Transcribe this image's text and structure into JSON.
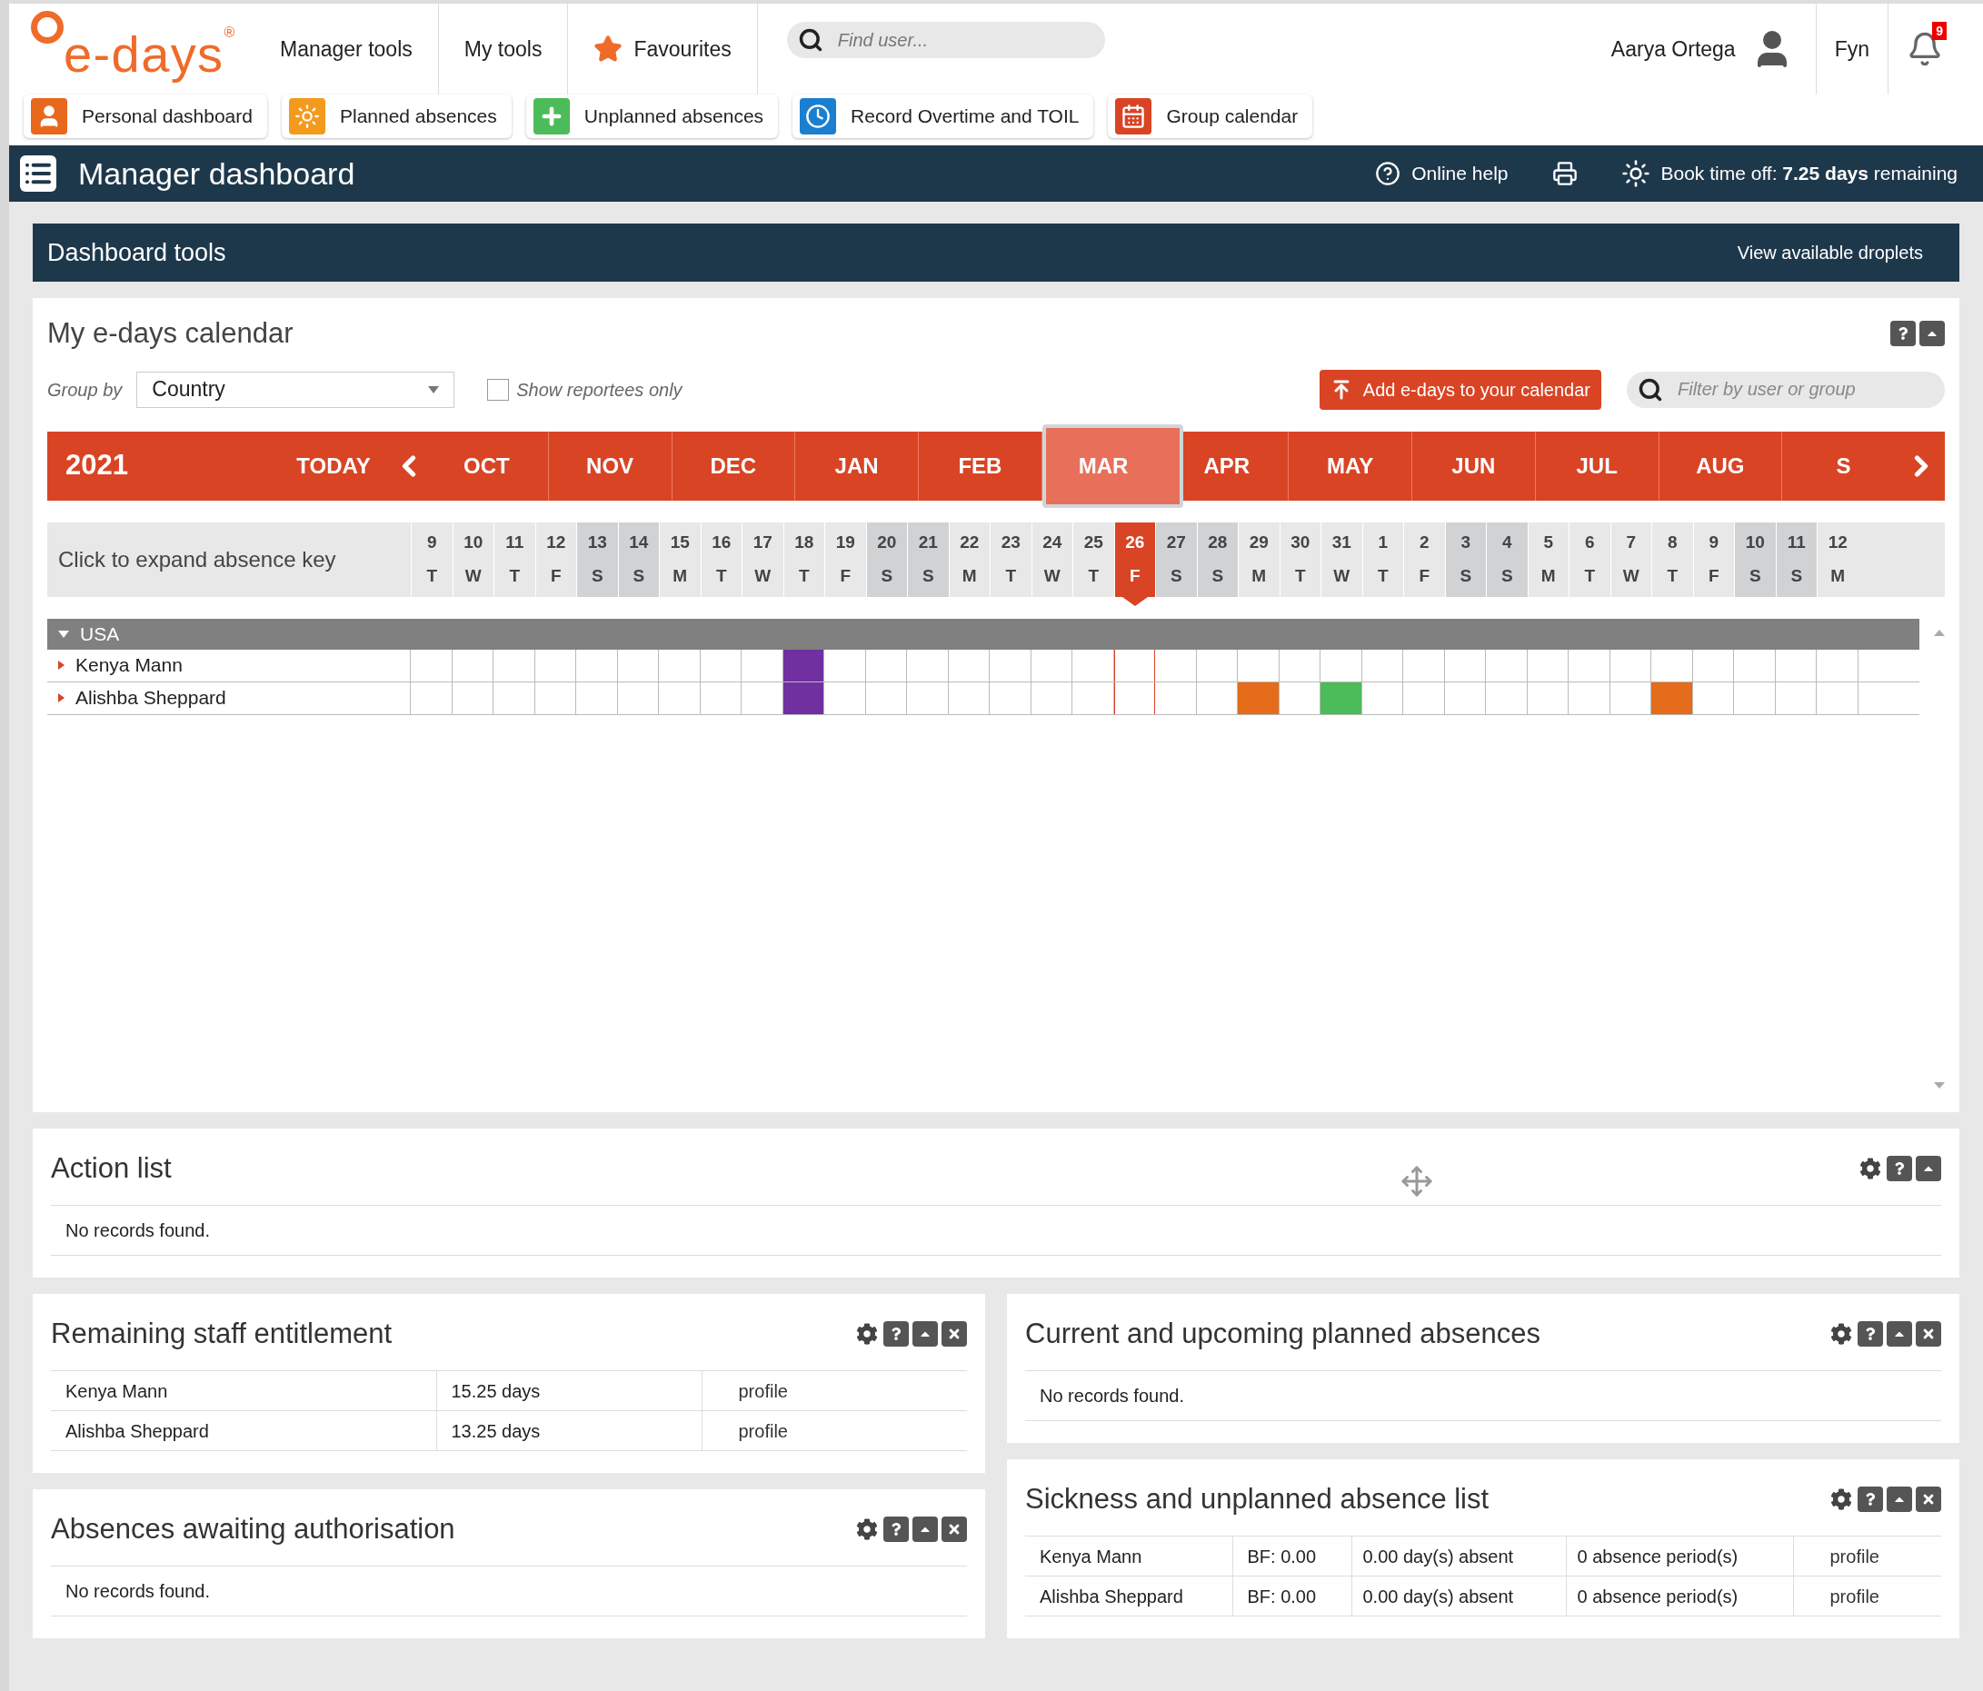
{
  "logo": {
    "text": "e-days",
    "mark": "®"
  },
  "top_nav": {
    "items": [
      {
        "label": "Manager tools",
        "kind": "plain"
      },
      {
        "label": "My tools",
        "kind": "plain"
      },
      {
        "label": "Favourites",
        "kind": "star"
      }
    ],
    "search": {
      "placeholder": "Find user..."
    },
    "user": "Aarya Ortega",
    "language": "Fyn",
    "notifications": "9"
  },
  "shortcuts": [
    {
      "label": "Personal dashboard",
      "kind": "person"
    },
    {
      "label": "Planned absences",
      "kind": "sun"
    },
    {
      "label": "Unplanned absences",
      "kind": "plus"
    },
    {
      "label": "Record Overtime and TOIL",
      "kind": "clock"
    },
    {
      "label": "Group calendar",
      "kind": "calendar"
    }
  ],
  "header": {
    "title": "Manager dashboard",
    "help": "Online help",
    "book_time_off": "Book time off: **7.25 days** remaining"
  },
  "dashboard_tools": {
    "title": "Dashboard tools",
    "link": "View available droplets"
  },
  "calendar": {
    "title": "My e-days calendar",
    "group_by_label": "Group by",
    "group_by": "Country",
    "reportees_only": {
      "label": "Show reportees only",
      "checked": false
    },
    "add_button": "Add e-days to your calendar",
    "filter": {
      "placeholder": "Filter by user or group"
    },
    "year": "2021",
    "today": "TODAY",
    "months": [
      {
        "label": "OCT",
        "selected": false
      },
      {
        "label": "NOV",
        "selected": false
      },
      {
        "label": "DEC",
        "selected": false
      },
      {
        "label": "JAN",
        "selected": false
      },
      {
        "label": "FEB",
        "selected": false
      },
      {
        "label": "MAR",
        "selected": true
      },
      {
        "label": "APR",
        "selected": false
      },
      {
        "label": "MAY",
        "selected": false
      },
      {
        "label": "JUN",
        "selected": false
      },
      {
        "label": "JUL",
        "selected": false
      },
      {
        "label": "AUG",
        "selected": false
      },
      {
        "label": "S",
        "selected": false
      }
    ],
    "absence_key": "Click to expand absence key",
    "days": [
      {
        "date": "9",
        "weekday": "T",
        "weekend": false,
        "today": false
      },
      {
        "date": "10",
        "weekday": "W",
        "weekend": false,
        "today": false
      },
      {
        "date": "11",
        "weekday": "T",
        "weekend": false,
        "today": false
      },
      {
        "date": "12",
        "weekday": "F",
        "weekend": false,
        "today": false
      },
      {
        "date": "13",
        "weekday": "S",
        "weekend": true,
        "today": false
      },
      {
        "date": "14",
        "weekday": "S",
        "weekend": true,
        "today": false
      },
      {
        "date": "15",
        "weekday": "M",
        "weekend": false,
        "today": false
      },
      {
        "date": "16",
        "weekday": "T",
        "weekend": false,
        "today": false
      },
      {
        "date": "17",
        "weekday": "W",
        "weekend": false,
        "today": false
      },
      {
        "date": "18",
        "weekday": "T",
        "weekend": false,
        "today": false
      },
      {
        "date": "19",
        "weekday": "F",
        "weekend": false,
        "today": false
      },
      {
        "date": "20",
        "weekday": "S",
        "weekend": true,
        "today": false
      },
      {
        "date": "21",
        "weekday": "S",
        "weekend": true,
        "today": false
      },
      {
        "date": "22",
        "weekday": "M",
        "weekend": false,
        "today": false
      },
      {
        "date": "23",
        "weekday": "T",
        "weekend": false,
        "today": false
      },
      {
        "date": "24",
        "weekday": "W",
        "weekend": false,
        "today": false
      },
      {
        "date": "25",
        "weekday": "T",
        "weekend": false,
        "today": false
      },
      {
        "date": "26",
        "weekday": "F",
        "weekend": false,
        "today": true
      },
      {
        "date": "27",
        "weekday": "S",
        "weekend": true,
        "today": false
      },
      {
        "date": "28",
        "weekday": "S",
        "weekend": true,
        "today": false
      },
      {
        "date": "29",
        "weekday": "M",
        "weekend": false,
        "today": false
      },
      {
        "date": "30",
        "weekday": "T",
        "weekend": false,
        "today": false
      },
      {
        "date": "31",
        "weekday": "W",
        "weekend": false,
        "today": false
      },
      {
        "date": "1",
        "weekday": "T",
        "weekend": false,
        "today": false
      },
      {
        "date": "2",
        "weekday": "F",
        "weekend": false,
        "today": false
      },
      {
        "date": "3",
        "weekday": "S",
        "weekend": true,
        "today": false
      },
      {
        "date": "4",
        "weekday": "S",
        "weekend": true,
        "today": false
      },
      {
        "date": "5",
        "weekday": "M",
        "weekend": false,
        "today": false
      },
      {
        "date": "6",
        "weekday": "T",
        "weekend": false,
        "today": false
      },
      {
        "date": "7",
        "weekday": "W",
        "weekend": false,
        "today": false
      },
      {
        "date": "8",
        "weekday": "T",
        "weekend": false,
        "today": false
      },
      {
        "date": "9",
        "weekday": "F",
        "weekend": false,
        "today": false
      },
      {
        "date": "10",
        "weekday": "S",
        "weekend": true,
        "today": false
      },
      {
        "date": "11",
        "weekday": "S",
        "weekend": true,
        "today": false
      },
      {
        "date": "12",
        "weekday": "M",
        "weekend": false,
        "today": false
      }
    ],
    "groups": [
      {
        "name": "USA",
        "expanded": true,
        "people": [
          {
            "name": "Kenya Mann",
            "cells": [
              {
                "absent": false
              },
              {
                "absent": false
              },
              {
                "absent": false
              },
              {
                "absent": false
              },
              {
                "absent": false
              },
              {
                "absent": false
              },
              {
                "absent": false
              },
              {
                "absent": false
              },
              {
                "absent": false
              },
              {
                "absent": true,
                "color": "#7030a0"
              },
              {
                "absent": false
              },
              {
                "absent": false
              },
              {
                "absent": false
              },
              {
                "absent": false
              },
              {
                "absent": false
              },
              {
                "absent": false
              },
              {
                "absent": false
              },
              {
                "absent": false
              },
              {
                "absent": false
              },
              {
                "absent": false
              },
              {
                "absent": false
              },
              {
                "absent": false
              },
              {
                "absent": false
              },
              {
                "absent": false
              },
              {
                "absent": false
              },
              {
                "absent": false
              },
              {
                "absent": false
              },
              {
                "absent": false
              },
              {
                "absent": false
              },
              {
                "absent": false
              },
              {
                "absent": false
              },
              {
                "absent": false
              },
              {
                "absent": false
              },
              {
                "absent": false
              },
              {
                "absent": false
              }
            ]
          },
          {
            "name": "Alishba Sheppard",
            "cells": [
              {
                "absent": false
              },
              {
                "absent": false
              },
              {
                "absent": false
              },
              {
                "absent": false
              },
              {
                "absent": false
              },
              {
                "absent": false
              },
              {
                "absent": false
              },
              {
                "absent": false
              },
              {
                "absent": false
              },
              {
                "absent": true,
                "color": "#7030a0"
              },
              {
                "absent": false
              },
              {
                "absent": false
              },
              {
                "absent": false
              },
              {
                "absent": false
              },
              {
                "absent": false
              },
              {
                "absent": false
              },
              {
                "absent": false
              },
              {
                "absent": false
              },
              {
                "absent": false
              },
              {
                "absent": false
              },
              {
                "absent": true,
                "color": "#e46c1a"
              },
              {
                "absent": false
              },
              {
                "absent": true,
                "color": "#4cbb5a"
              },
              {
                "absent": false
              },
              {
                "absent": false
              },
              {
                "absent": false
              },
              {
                "absent": false
              },
              {
                "absent": false
              },
              {
                "absent": false
              },
              {
                "absent": false
              },
              {
                "absent": true,
                "color": "#e46c1a"
              },
              {
                "absent": false
              },
              {
                "absent": false
              },
              {
                "absent": false
              },
              {
                "absent": false
              }
            ]
          }
        ]
      }
    ]
  },
  "action_list": {
    "title": "Action list",
    "empty": "No records found."
  },
  "remaining_entitlement": {
    "title": "Remaining staff entitlement",
    "rows": [
      {
        "name": "Kenya Mann",
        "days": "15.25 days",
        "link": "profile"
      },
      {
        "name": "Alishba Sheppard",
        "days": "13.25 days",
        "link": "profile"
      }
    ]
  },
  "awaiting_authorisation": {
    "title": "Absences awaiting authorisation",
    "empty": "No records found."
  },
  "planned_absences": {
    "title": "Current and upcoming planned absences",
    "empty": "No records found."
  },
  "sickness": {
    "title": "Sickness and unplanned absence list",
    "rows": [
      {
        "name": "Kenya Mann",
        "bf": "BF: 0.00",
        "days": "0.00 day(s) absent",
        "periods": "0 absence period(s)",
        "link": "profile"
      },
      {
        "name": "Alishba Sheppard",
        "bf": "BF: 0.00",
        "days": "0.00 day(s) absent",
        "periods": "0 absence period(s)",
        "link": "profile"
      }
    ]
  }
}
